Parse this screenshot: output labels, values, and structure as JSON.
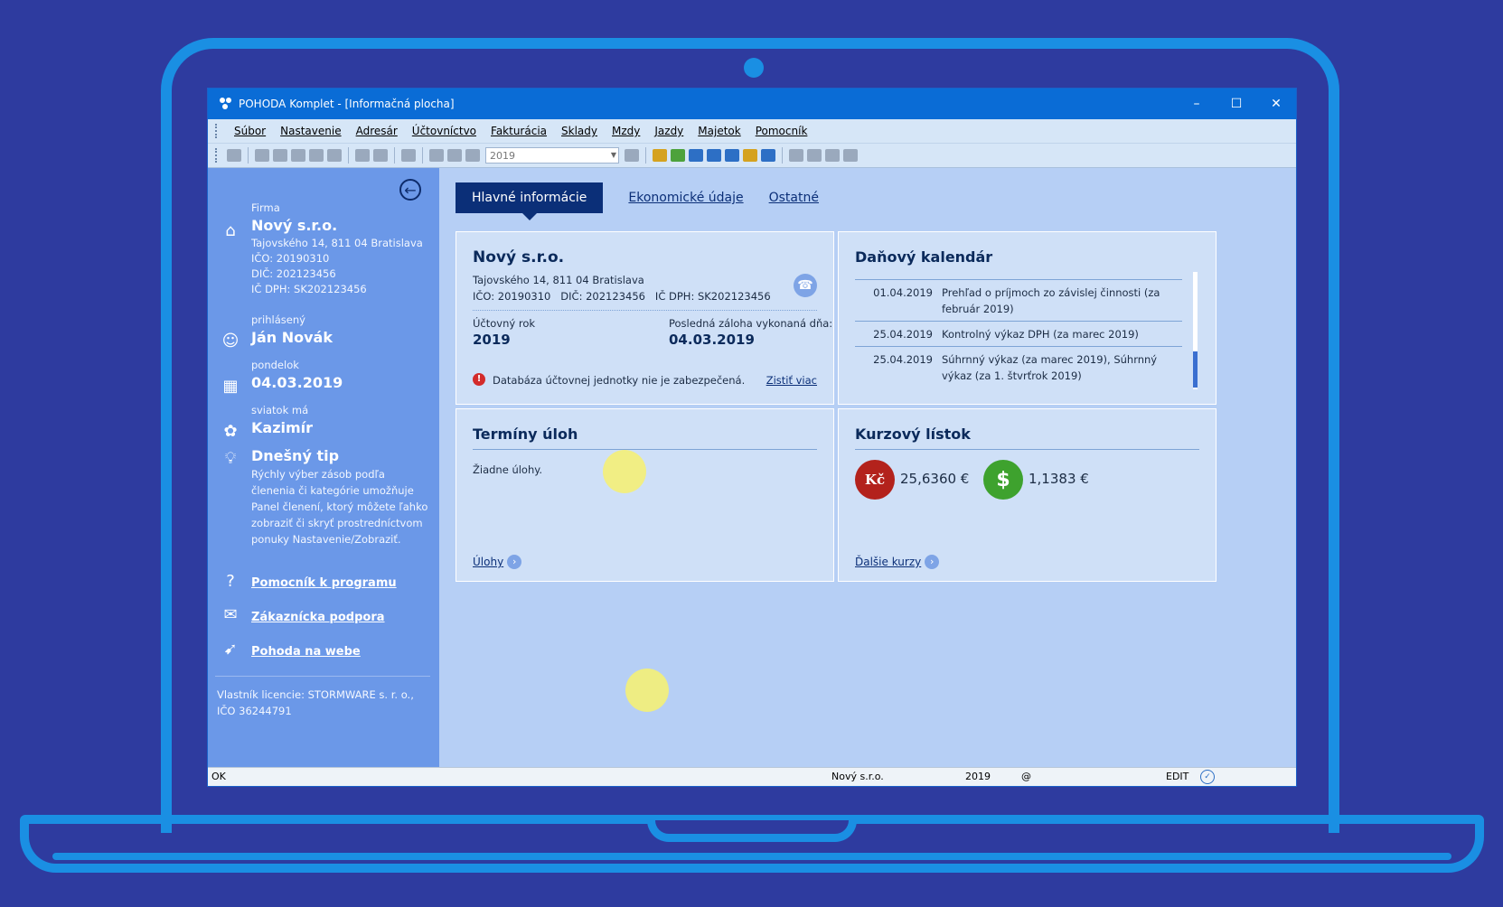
{
  "window": {
    "title": "POHODA Komplet - [Informačná plocha]",
    "minimize": "–",
    "maximize": "☐",
    "close": "✕"
  },
  "menu": [
    "Súbor",
    "Nastavenie",
    "Adresár",
    "Účtovníctvo",
    "Fakturácia",
    "Sklady",
    "Mzdy",
    "Jazdy",
    "Majetok",
    "Pomocník"
  ],
  "toolbar": {
    "year": "2019"
  },
  "sidebar": {
    "firm_label": "Firma",
    "firm_name": "Nový s.r.o.",
    "firm_address": "Tajovského 14, 811 04 Bratislava",
    "firm_ico": "IČO: 20190310",
    "firm_dic": "DIČ: 202123456",
    "firm_icdph": "IČ DPH: SK202123456",
    "user_label": "prihlásený",
    "user_name": "Ján Novák",
    "day_label": "pondelok",
    "date": "04.03.2019",
    "nameday_label": "sviatok má",
    "nameday_name": "Kazimír",
    "tip_title": "Dnešný tip",
    "tip_text": "Rýchly výber zásob podľa členenia či kategórie umožňuje Panel členení, ktorý môžete ľahko zobraziť či skryť prostredníctvom ponuky Nastavenie/Zobraziť.",
    "link_help": "Pomocník k programu",
    "link_support": "Zákaznícka podpora",
    "link_web": "Pohoda na webe",
    "license": "Vlastník licencie: STORMWARE s. r. o., IČO 36244791"
  },
  "tabs": {
    "active": "Hlavné informácie",
    "tab2": "Ekonomické údaje",
    "tab3": "Ostatné"
  },
  "company_card": {
    "name": "Nový s.r.o.",
    "address": "Tajovského 14, 811 04 Bratislava",
    "ids": "IČO: 20190310   DIČ: 202123456   IČ DPH: SK202123456",
    "year_label": "Účtovný rok",
    "year": "2019",
    "backup_label": "Posledná záloha vykonaná dňa:",
    "backup_date": "04.03.2019",
    "warning": "Databáza účtovnej jednotky nie je zabezpečená.",
    "warning_link": "Zistiť viac"
  },
  "tax_calendar": {
    "title": "Daňový kalendár",
    "rows": [
      {
        "date": "01.04.2019",
        "text": "Prehľad o príjmoch zo závislej činnosti (za február 2019)"
      },
      {
        "date": "25.04.2019",
        "text": "Kontrolný výkaz DPH (za marec 2019)"
      },
      {
        "date": "25.04.2019",
        "text": "Súhrnný výkaz (za marec 2019), Súhrnný výkaz (za 1. štvrťrok 2019)"
      }
    ]
  },
  "tasks": {
    "title": "Termíny úloh",
    "empty": "Žiadne úlohy.",
    "link": "Úlohy"
  },
  "rates": {
    "title": "Kurzový lístok",
    "czk_symbol": "Kč",
    "czk": "25,6360 €",
    "usd_symbol": "$",
    "usd": "1,1383 €",
    "link": "Ďalšie kurzy"
  },
  "status": {
    "ok": "OK",
    "firm": "Nový s.r.o.",
    "year": "2019",
    "at": "@",
    "mode": "EDIT"
  },
  "colors": {
    "accent": "#0b2f78",
    "sidebar": "#6b98e8",
    "frame": "#1a8fe3"
  }
}
